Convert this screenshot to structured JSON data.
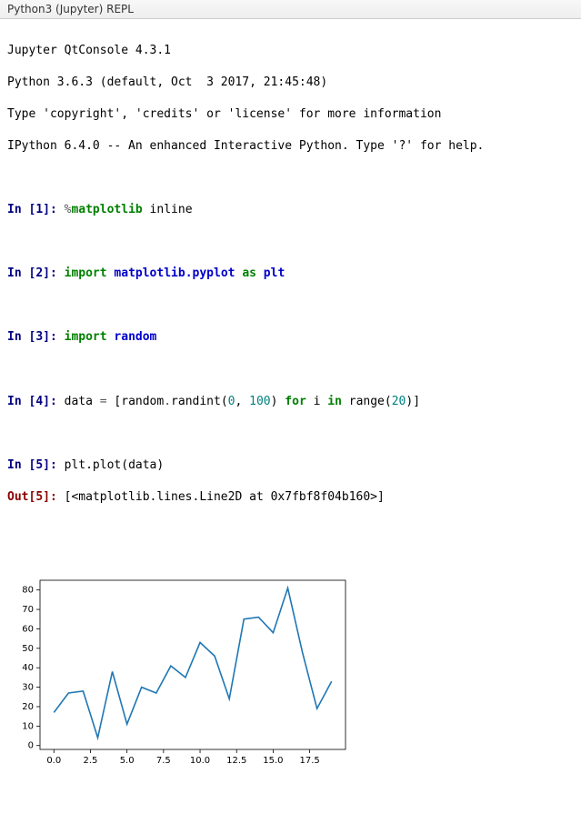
{
  "titlebar": {
    "text": "Python3 (Jupyter) REPL"
  },
  "banner": {
    "line1": "Jupyter QtConsole 4.3.1",
    "line2": "Python 3.6.3 (default, Oct  3 2017, 21:45:48)",
    "line3": "Type 'copyright', 'credits' or 'license' for more information",
    "line4": "IPython 6.4.0 -- An enhanced Interactive Python. Type '?' for help."
  },
  "prompts": {
    "in_prefix": "In [",
    "in_suffix": "]:",
    "out_prefix": "Out[",
    "out_suffix": "]:"
  },
  "cells": {
    "c1": {
      "n": "1",
      "magic_pct": "%",
      "magic_name": "matplotlib",
      "magic_arg": " inline"
    },
    "c2": {
      "n": "2",
      "kw1": "import",
      "mod": "matplotlib.pyplot",
      "kw2": "as",
      "alias": "plt"
    },
    "c3": {
      "n": "3",
      "kw1": "import",
      "mod": "random"
    },
    "c4": {
      "n": "4",
      "lhs": "data ",
      "eq": "=",
      "open": " [random",
      "dot1": ".",
      "fn": "randint",
      "paren_open": "(",
      "arg0": "0",
      "comma": ", ",
      "arg1": "100",
      "paren_close": ") ",
      "kw_for": "for",
      "var_i": " i ",
      "kw_in": "in",
      "range_txt": " range(",
      "arg2": "20",
      "close": ")]"
    },
    "c5": {
      "n": "5",
      "code": "plt.plot(data)",
      "out": "[<matplotlib.lines.Line2D at 0x7fbf8f04b160>]"
    }
  },
  "chart_data": {
    "type": "line",
    "x": [
      0,
      1,
      2,
      3,
      4,
      5,
      6,
      7,
      8,
      9,
      10,
      11,
      12,
      13,
      14,
      15,
      16,
      17,
      18,
      19
    ],
    "values": [
      17,
      27,
      28,
      4,
      38,
      11,
      30,
      27,
      41,
      35,
      53,
      46,
      24,
      65,
      66,
      58,
      81,
      48,
      19,
      33
    ],
    "x_ticks": [
      "0.0",
      "2.5",
      "5.0",
      "7.5",
      "10.0",
      "12.5",
      "15.0",
      "17.5"
    ],
    "x_tick_vals": [
      0,
      2.5,
      5,
      7.5,
      10,
      12.5,
      15,
      17.5
    ],
    "y_ticks": [
      "0",
      "10",
      "20",
      "30",
      "40",
      "50",
      "60",
      "70",
      "80"
    ],
    "y_tick_vals": [
      0,
      10,
      20,
      30,
      40,
      50,
      60,
      70,
      80
    ],
    "xlim": [
      -0.95,
      19.95
    ],
    "ylim": [
      -2,
      85
    ],
    "line_color": "#1f77b4"
  }
}
